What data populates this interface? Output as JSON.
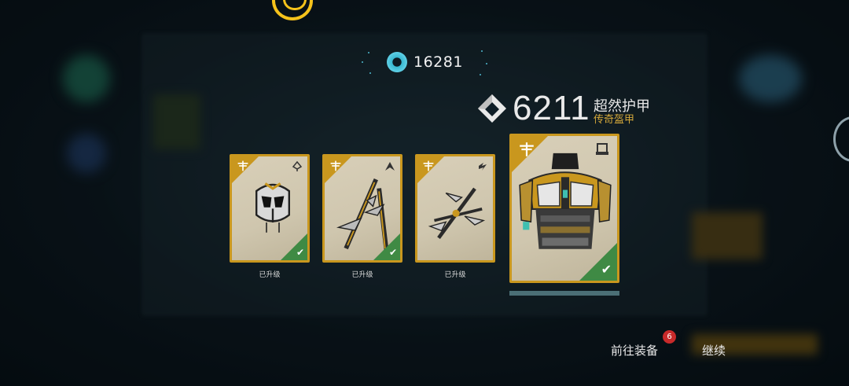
{
  "currency": {
    "value": "16281",
    "icon": "glimmer-icon"
  },
  "item": {
    "power": "6211",
    "name": "超然护甲",
    "type": "传奇盔甲"
  },
  "cards": [
    {
      "label": "已升级",
      "slot_icon": "helmet-slot-icon",
      "art": "helmet-icon",
      "upgraded": true
    },
    {
      "label": "已升级",
      "slot_icon": "arms-slot-icon",
      "art": "weapon-icon",
      "upgraded": true
    },
    {
      "label": "已升级",
      "slot_icon": "class-item-slot-icon",
      "art": "weapon-icon",
      "upgraded": true
    },
    {
      "label": "",
      "slot_icon": "chest-slot-icon",
      "art": "chest-armor-icon",
      "upgraded": true,
      "selected": true
    }
  ],
  "actions": {
    "equip_label": "前往装备",
    "equip_badge": "6",
    "continue_label": "继续"
  },
  "colors": {
    "gold": "#c9971e",
    "check_green": "#3f8a44",
    "accent_teal": "#4fb8cf",
    "type_gold": "#d4a83a"
  }
}
